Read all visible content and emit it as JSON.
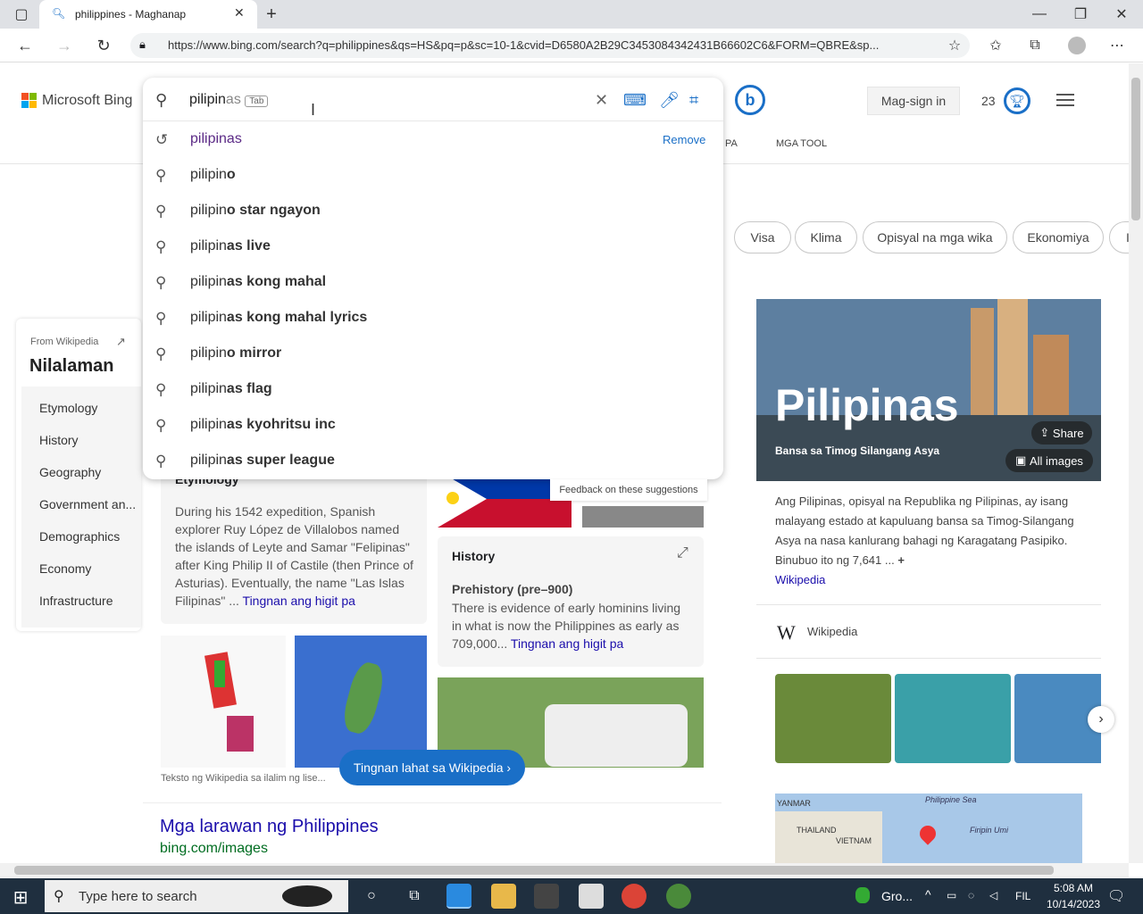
{
  "browser": {
    "tab_title": "philippines - Maghanap",
    "url": "https://www.bing.com/search?q=philippines&qs=HS&pq=p&sc=10-1&cvid=D6580A2B29C3453084342431B66602C6&FORM=QBRE&sp..."
  },
  "bing": {
    "brand": "Microsoft Bing",
    "signin": "Mag-sign in",
    "points": "23",
    "nav_partial": "PA",
    "nav_tools": "MGA TOOL"
  },
  "search": {
    "typed": "pilipin",
    "ghost": "as",
    "tab_hint": "Tab"
  },
  "suggestions": [
    {
      "base": "pilipin",
      "rest": "as",
      "kind": "history"
    },
    {
      "base": "pilipin",
      "rest": "o",
      "kind": "search"
    },
    {
      "base": "pilipin",
      "rest": "o star ngayon",
      "kind": "search"
    },
    {
      "base": "pilipin",
      "rest": "as live",
      "kind": "search"
    },
    {
      "base": "pilipin",
      "rest": "as kong mahal",
      "kind": "search"
    },
    {
      "base": "pilipin",
      "rest": "as kong mahal lyrics",
      "kind": "search"
    },
    {
      "base": "pilipin",
      "rest": "o mirror",
      "kind": "search"
    },
    {
      "base": "pilipin",
      "rest": "as flag",
      "kind": "search"
    },
    {
      "base": "pilipin",
      "rest": "as kyohritsu inc",
      "kind": "search"
    },
    {
      "base": "pilipin",
      "rest": "as super league",
      "kind": "search"
    }
  ],
  "remove_label": "Remove",
  "feedback": "Feedback on these suggestions",
  "pills": [
    "Visa",
    "Klima",
    "Opisyal na mga wika",
    "Ekonomiya",
    "I"
  ],
  "toc": {
    "source": "From Wikipedia",
    "title": "Nilalaman",
    "items": [
      "Etymology",
      "History",
      "Geography",
      "Government an...",
      "Demographics",
      "Economy",
      "Infrastructure"
    ]
  },
  "etym": {
    "title": "Etymology",
    "body": "During his 1542 expedition, Spanish explorer Ruy López de Villalobos named the islands of Leyte and Samar \"Felipinas\" after King Philip II of Castile (then Prince of Asturias). Eventually, the name \"Las Islas Filipinas\" ...",
    "more": "Tingnan ang higit pa"
  },
  "history": {
    "title": "History",
    "sub": "Prehistory (pre–900)",
    "body": "There is evidence of early hominins living in what is now the Philippines as early as 709,000...",
    "more": "Tingnan ang higit pa"
  },
  "wiki_button": "Tingnan lahat sa Wikipedia",
  "wiki_note": "Teksto ng Wikipedia sa ilalim ng lise...",
  "images_result": {
    "title": "Mga larawan ng Philippines",
    "url": "bing.com/images"
  },
  "infobox": {
    "title": "Pilipinas",
    "subtitle": "Bansa sa Timog Silangang Asya",
    "share": "Share",
    "all_images": "All images",
    "desc": "Ang Pilipinas, opisyal na Republika ng Pilipinas, ay isang malayang estado at kapuluang bansa sa Timog-Silangang Asya na nasa kanlurang bahagi ng Karagatang Pasipiko. Binubuo ito ng 7,641 ...",
    "wiki_link": "Wikipedia",
    "wiki_source": "Wikipedia",
    "map_labels": {
      "sea": "Philippine Sea",
      "yanmar": "YANMAR",
      "thailand": "THAILAND",
      "vietnam": "VIETNAM",
      "firipin": "Firipin Umi"
    }
  },
  "taskbar": {
    "search_placeholder": "Type here to search",
    "weather": "Gro...",
    "lang": "FIL",
    "time": "5:08 AM",
    "date": "10/14/2023"
  },
  "colors": {
    "bing_blue": "#1a6fc7",
    "link": "#1a0dab",
    "taskbar": "#1f2f3f"
  }
}
